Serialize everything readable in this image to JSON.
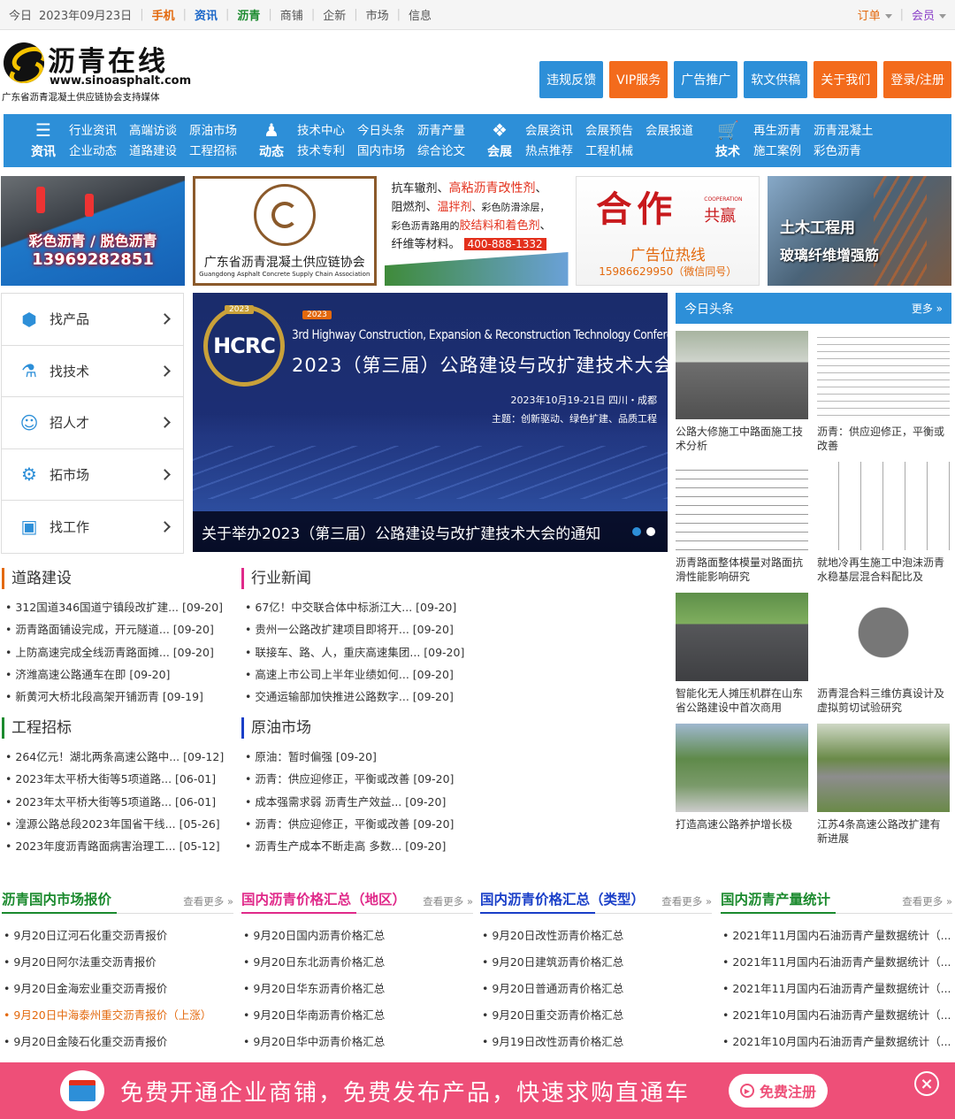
{
  "topbar": {
    "today_label": "今日",
    "date": "2023年09月23日",
    "links": [
      {
        "label": "手机",
        "color": "#e3690d"
      },
      {
        "label": "资讯",
        "color": "#1a66c8"
      },
      {
        "label": "沥青",
        "color": "#1b8a2e"
      },
      {
        "label": "商铺",
        "color": "#555555"
      },
      {
        "label": "企新",
        "color": "#555555"
      },
      {
        "label": "市场",
        "color": "#555555"
      },
      {
        "label": "信息",
        "color": "#555555"
      }
    ],
    "order": "订单",
    "member": "会员"
  },
  "logo": {
    "title": "沥青在线",
    "url": "www.sinoasphalt.com",
    "subtitle": "广东省沥青混凝土供应链协会支持媒体"
  },
  "header_buttons": [
    {
      "label": "违规反馈",
      "color": "#2d8fd8"
    },
    {
      "label": "VIP服务",
      "color": "#f36b1c"
    },
    {
      "label": "广告推广",
      "color": "#2d8fd8"
    },
    {
      "label": "软文供稿",
      "color": "#2d8fd8"
    },
    {
      "label": "关于我们",
      "color": "#f36b1c"
    },
    {
      "label": "登录/注册",
      "color": "#f36b1c"
    }
  ],
  "nav": [
    {
      "head": "资讯",
      "icon": "newspaper-icon",
      "cols": [
        [
          "行业资讯",
          "企业动态"
        ],
        [
          "高端访谈",
          "道路建设"
        ],
        [
          "原油市场",
          "工程招标"
        ]
      ]
    },
    {
      "head": "动态",
      "icon": "person-icon",
      "cols": [
        [
          "技术中心",
          "技术专利"
        ],
        [
          "今日头条",
          "国内市场"
        ],
        [
          "沥青产量",
          "综合论文"
        ]
      ]
    },
    {
      "head": "会展",
      "icon": "cubes-icon",
      "cols": [
        [
          "会展资讯",
          "热点推荐"
        ],
        [
          "会展预告",
          "工程机械"
        ],
        [
          "会展报道",
          ""
        ]
      ]
    },
    {
      "head": "技术",
      "icon": "cart-icon",
      "cols": [
        [
          "再生沥青",
          "施工案例"
        ],
        [
          "沥青混凝土",
          "彩色沥青"
        ]
      ]
    }
  ],
  "banners": {
    "b1_line1": "彩色沥青 / 脱色沥青",
    "b1_line2": "13969282851",
    "b2_title": "广东省沥青混凝土供应链协会",
    "b2_en": "Guangdong Asphalt Concrete Supply Chain Association",
    "b3_seg1": "抗车辙剂、",
    "b3_seg2": "高粘沥青改性剂",
    "b3_seg3": "、",
    "b3_seg4": "阻燃剂、",
    "b3_seg5": "温拌剂",
    "b3_seg6": "、彩色防滑涂层，",
    "b3_seg7": "彩色沥青路用的",
    "b3_seg8": "胶结料和着色剂",
    "b3_seg9": "、",
    "b3_seg10": "纤维等材料。",
    "b3_phone": "400-888-1332",
    "b4_big": "合作",
    "b4_small": "共赢",
    "b4_en": "COOPERATION",
    "b4_hotline": "广告位热线",
    "b4_phone": "15986629950（微信同号）",
    "b5_line1": "土木工程用",
    "b5_line2": "玻璃纤维增强筋"
  },
  "left_menu": [
    {
      "label": "找产品",
      "icon": "cube-icon"
    },
    {
      "label": "找技术",
      "icon": "flask-icon"
    },
    {
      "label": "招人才",
      "icon": "graduate-icon"
    },
    {
      "label": "拓市场",
      "icon": "gear-icon"
    },
    {
      "label": "找工作",
      "icon": "briefcase-icon"
    }
  ],
  "slider": {
    "badge_year": "2023",
    "badge_text": "HCRC",
    "tag_year": "2023",
    "title_en": "3rd Highway Construction, Expansion & Reconstruction Technology Conference",
    "title_cn": "2023（第三届）公路建设与改扩建技术大会",
    "date": "2023年10月19-21日  四川・成都",
    "theme": "主题：创新驱动、绿色扩建、品质工程",
    "caption": "关于举办2023（第三届）公路建设与改扩建技术大会的通知"
  },
  "sections": {
    "road": {
      "title": "道路建设",
      "color": "#e3690d",
      "items": [
        "312国道346国道宁镇段改扩建... [09-20]",
        "沥青路面铺设完成，开元隧道... [09-20]",
        "上防高速完成全线沥青路面摊... [09-20]",
        "济潍高速公路通车在即 [09-20]",
        "新黄河大桥北段高架开铺沥青 [09-19]"
      ]
    },
    "industry": {
      "title": "行业新闻",
      "color": "#e02a8a",
      "items": [
        "67亿！中交联合体中标浙江大... [09-20]",
        "贵州一公路改扩建项目即将开... [09-20]",
        "联接车、路、人，重庆高速集团... [09-20]",
        "高速上市公司上半年业绩如何... [09-20]",
        "交通运输部加快推进公路数字... [09-20]"
      ]
    },
    "bidding": {
      "title": "工程招标",
      "color": "#1b8a2e",
      "items": [
        "264亿元！湖北两条高速公路中... [09-12]",
        "2023年太平桥大街等5项道路... [06-01]",
        "2023年太平桥大街等5项道路... [06-01]",
        "湟源公路总段2023年国省干线... [05-26]",
        "2023年度沥青路面病害治理工... [05-12]"
      ]
    },
    "crude": {
      "title": "原油市场",
      "color": "#1a3fc8",
      "items": [
        "原油：暂时偏强 [09-20]",
        "沥青：供应迎修正，平衡或改善 [09-20]",
        "成本强需求弱 沥青生产效益... [09-20]",
        "沥青：供应迎修正，平衡或改善 [09-20]",
        "沥青生产成本不断走高 多数... [09-20]"
      ]
    }
  },
  "headlines": {
    "title": "今日头条",
    "more": "更多 »",
    "cards": [
      {
        "caption": "公路大修施工中路面施工技术分析"
      },
      {
        "caption": "沥青：供应迎修正，平衡或改善"
      },
      {
        "caption": "沥青路面整体模量对路面抗滑性能影响研究"
      },
      {
        "caption": "就地冷再生施工中泡沫沥青水稳基层混合料配比及"
      },
      {
        "caption": "智能化无人摊压机群在山东省公路建设中首次商用"
      },
      {
        "caption": "沥青混合料三维仿真设计及虚拟剪切试验研究"
      },
      {
        "caption": "打造高速公路养护增长极"
      },
      {
        "caption": "江苏4条高速公路改扩建有新进展"
      }
    ]
  },
  "price_tables": [
    {
      "title": "沥青国内市场报价",
      "accent": "#1b8a2e",
      "title_color": "#1b8a2e",
      "more": "查看更多 »",
      "items": [
        "9月20日辽河石化重交沥青报价",
        "9月20日阿尔法重交沥青报价",
        "9月20日金海宏业重交沥青报价",
        "9月20日中海泰州重交沥青报价（上涨）",
        "9月20日金陵石化重交沥青报价"
      ]
    },
    {
      "title": "国内沥青价格汇总（地区）",
      "accent": "#e02a8a",
      "title_color": "#e02a8a",
      "more": "查看更多 »",
      "items": [
        "9月20日国内沥青价格汇总",
        "9月20日东北沥青价格汇总",
        "9月20日华东沥青价格汇总",
        "9月20日华南沥青价格汇总",
        "9月20日华中沥青价格汇总"
      ]
    },
    {
      "title": "国内沥青价格汇总（类型）",
      "accent": "#1a3fc8",
      "title_color": "#1a3fc8",
      "more": "查看更多 »",
      "items": [
        "9月20日改性沥青价格汇总",
        "9月20日建筑沥青价格汇总",
        "9月20日普通沥青价格汇总",
        "9月20日重交沥青价格汇总",
        "9月19日改性沥青价格汇总"
      ]
    },
    {
      "title": "国内沥青产量统计",
      "accent": "#1b8a2e",
      "title_color": "#1b8a2e",
      "more": "查看更多 »",
      "items": [
        "2021年11月国内石油沥青产量数据统计（...",
        "2021年11月国内石油沥青产量数据统计（...",
        "2021年11月国内石油沥青产量数据统计（...",
        "2021年10月国内石油沥青产量数据统计（...",
        "2021年10月国内石油沥青产量数据统计（..."
      ]
    }
  ],
  "footer": {
    "text": "免费开通企业商铺，免费发布产品，快速求购直通车",
    "register": "免费注册",
    "close": "×"
  }
}
